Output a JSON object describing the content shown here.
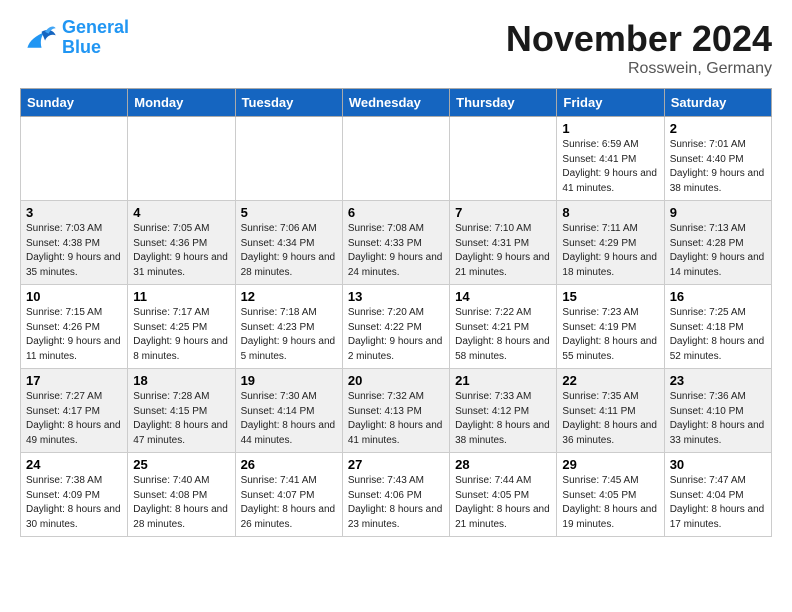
{
  "header": {
    "logo_line1": "General",
    "logo_line2": "Blue",
    "month_title": "November 2024",
    "location": "Rosswein, Germany"
  },
  "weekdays": [
    "Sunday",
    "Monday",
    "Tuesday",
    "Wednesday",
    "Thursday",
    "Friday",
    "Saturday"
  ],
  "weeks": [
    [
      {
        "day": "",
        "info": ""
      },
      {
        "day": "",
        "info": ""
      },
      {
        "day": "",
        "info": ""
      },
      {
        "day": "",
        "info": ""
      },
      {
        "day": "",
        "info": ""
      },
      {
        "day": "1",
        "info": "Sunrise: 6:59 AM\nSunset: 4:41 PM\nDaylight: 9 hours and 41 minutes."
      },
      {
        "day": "2",
        "info": "Sunrise: 7:01 AM\nSunset: 4:40 PM\nDaylight: 9 hours and 38 minutes."
      }
    ],
    [
      {
        "day": "3",
        "info": "Sunrise: 7:03 AM\nSunset: 4:38 PM\nDaylight: 9 hours and 35 minutes."
      },
      {
        "day": "4",
        "info": "Sunrise: 7:05 AM\nSunset: 4:36 PM\nDaylight: 9 hours and 31 minutes."
      },
      {
        "day": "5",
        "info": "Sunrise: 7:06 AM\nSunset: 4:34 PM\nDaylight: 9 hours and 28 minutes."
      },
      {
        "day": "6",
        "info": "Sunrise: 7:08 AM\nSunset: 4:33 PM\nDaylight: 9 hours and 24 minutes."
      },
      {
        "day": "7",
        "info": "Sunrise: 7:10 AM\nSunset: 4:31 PM\nDaylight: 9 hours and 21 minutes."
      },
      {
        "day": "8",
        "info": "Sunrise: 7:11 AM\nSunset: 4:29 PM\nDaylight: 9 hours and 18 minutes."
      },
      {
        "day": "9",
        "info": "Sunrise: 7:13 AM\nSunset: 4:28 PM\nDaylight: 9 hours and 14 minutes."
      }
    ],
    [
      {
        "day": "10",
        "info": "Sunrise: 7:15 AM\nSunset: 4:26 PM\nDaylight: 9 hours and 11 minutes."
      },
      {
        "day": "11",
        "info": "Sunrise: 7:17 AM\nSunset: 4:25 PM\nDaylight: 9 hours and 8 minutes."
      },
      {
        "day": "12",
        "info": "Sunrise: 7:18 AM\nSunset: 4:23 PM\nDaylight: 9 hours and 5 minutes."
      },
      {
        "day": "13",
        "info": "Sunrise: 7:20 AM\nSunset: 4:22 PM\nDaylight: 9 hours and 2 minutes."
      },
      {
        "day": "14",
        "info": "Sunrise: 7:22 AM\nSunset: 4:21 PM\nDaylight: 8 hours and 58 minutes."
      },
      {
        "day": "15",
        "info": "Sunrise: 7:23 AM\nSunset: 4:19 PM\nDaylight: 8 hours and 55 minutes."
      },
      {
        "day": "16",
        "info": "Sunrise: 7:25 AM\nSunset: 4:18 PM\nDaylight: 8 hours and 52 minutes."
      }
    ],
    [
      {
        "day": "17",
        "info": "Sunrise: 7:27 AM\nSunset: 4:17 PM\nDaylight: 8 hours and 49 minutes."
      },
      {
        "day": "18",
        "info": "Sunrise: 7:28 AM\nSunset: 4:15 PM\nDaylight: 8 hours and 47 minutes."
      },
      {
        "day": "19",
        "info": "Sunrise: 7:30 AM\nSunset: 4:14 PM\nDaylight: 8 hours and 44 minutes."
      },
      {
        "day": "20",
        "info": "Sunrise: 7:32 AM\nSunset: 4:13 PM\nDaylight: 8 hours and 41 minutes."
      },
      {
        "day": "21",
        "info": "Sunrise: 7:33 AM\nSunset: 4:12 PM\nDaylight: 8 hours and 38 minutes."
      },
      {
        "day": "22",
        "info": "Sunrise: 7:35 AM\nSunset: 4:11 PM\nDaylight: 8 hours and 36 minutes."
      },
      {
        "day": "23",
        "info": "Sunrise: 7:36 AM\nSunset: 4:10 PM\nDaylight: 8 hours and 33 minutes."
      }
    ],
    [
      {
        "day": "24",
        "info": "Sunrise: 7:38 AM\nSunset: 4:09 PM\nDaylight: 8 hours and 30 minutes."
      },
      {
        "day": "25",
        "info": "Sunrise: 7:40 AM\nSunset: 4:08 PM\nDaylight: 8 hours and 28 minutes."
      },
      {
        "day": "26",
        "info": "Sunrise: 7:41 AM\nSunset: 4:07 PM\nDaylight: 8 hours and 26 minutes."
      },
      {
        "day": "27",
        "info": "Sunrise: 7:43 AM\nSunset: 4:06 PM\nDaylight: 8 hours and 23 minutes."
      },
      {
        "day": "28",
        "info": "Sunrise: 7:44 AM\nSunset: 4:05 PM\nDaylight: 8 hours and 21 minutes."
      },
      {
        "day": "29",
        "info": "Sunrise: 7:45 AM\nSunset: 4:05 PM\nDaylight: 8 hours and 19 minutes."
      },
      {
        "day": "30",
        "info": "Sunrise: 7:47 AM\nSunset: 4:04 PM\nDaylight: 8 hours and 17 minutes."
      }
    ]
  ]
}
